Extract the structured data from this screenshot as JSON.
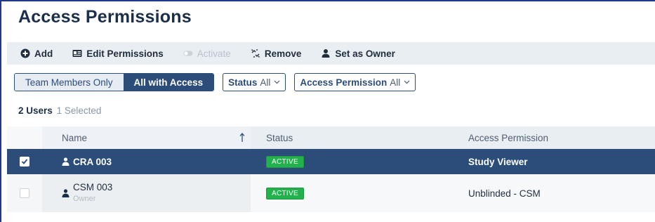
{
  "page": {
    "title": "Access Permissions"
  },
  "toolbar": {
    "add_label": "Add",
    "edit_label": "Edit Permissions",
    "activate_label": "Activate",
    "remove_label": "Remove",
    "owner_label": "Set as Owner"
  },
  "filters": {
    "team_members_label": "Team Members Only",
    "all_access_label": "All with Access",
    "active_segment": "All with Access",
    "status_label": "Status",
    "status_value": "All",
    "permission_label": "Access Permission",
    "permission_value": "All"
  },
  "summary": {
    "users_count": "2 Users",
    "selected_text": "1 Selected"
  },
  "table": {
    "columns": {
      "name": "Name",
      "status": "Status",
      "access": "Access Permission"
    },
    "sort": {
      "column": "Name",
      "direction": "ascending"
    },
    "rows": [
      {
        "name": "CRA 003",
        "role": "",
        "status": "ACTIVE",
        "access": "Study Viewer",
        "selected": true
      },
      {
        "name": "CSM 003",
        "role": "Owner",
        "status": "ACTIVE",
        "access": "Unblinded - CSM",
        "selected": false
      }
    ]
  },
  "colors": {
    "primary": "#2c4c7a",
    "toolbar_bg": "#e9eef3",
    "active_badge": "#22b14c",
    "disabled_text": "#b9c2cc"
  },
  "icons": {
    "add": "plus-circle-icon",
    "edit": "id-card-icon",
    "activate": "toggle-icon",
    "remove": "broken-link-icon",
    "owner": "user-icon",
    "sort": "arrow-up-icon"
  }
}
